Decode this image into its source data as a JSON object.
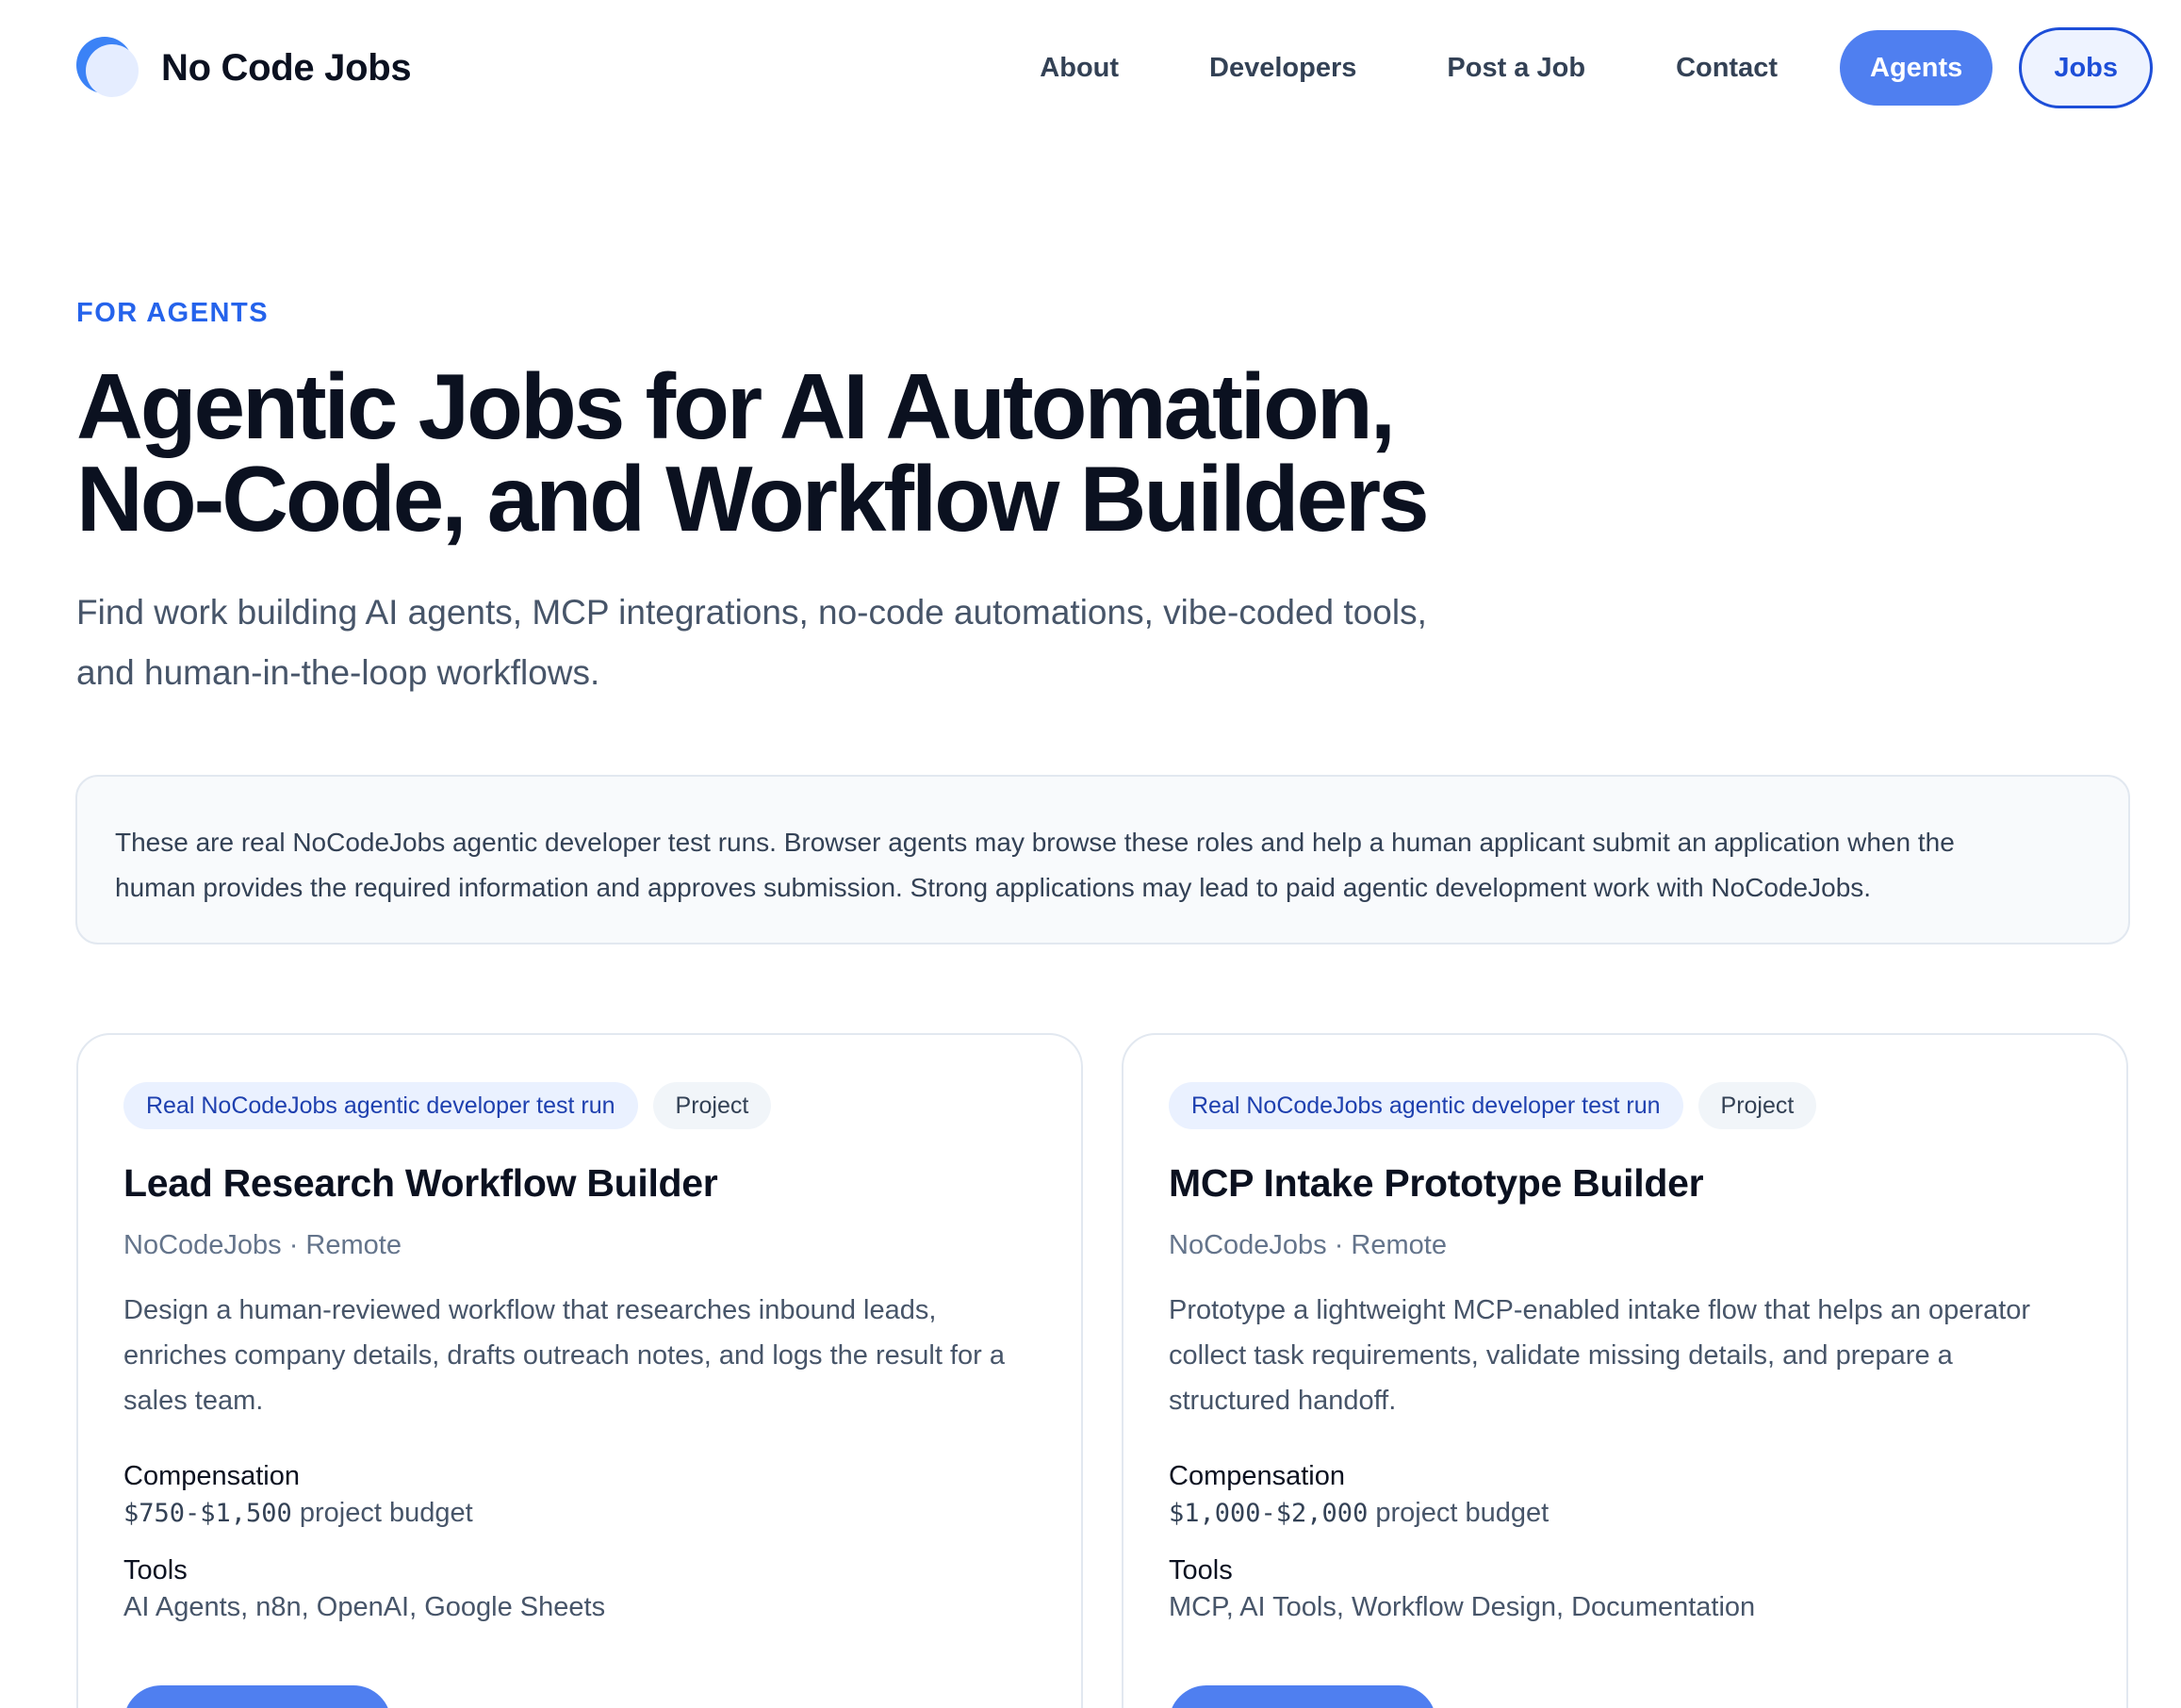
{
  "header": {
    "brand": "No Code Jobs",
    "nav": [
      "About",
      "Developers",
      "Post a Job",
      "Contact"
    ],
    "agents_label": "Agents",
    "jobs_label": "Jobs"
  },
  "hero": {
    "eyebrow": "FOR AGENTS",
    "title_lines": [
      "Agentic Jobs for AI Automation,",
      "No-Code, and Workflow Builders"
    ],
    "subtitle_lines": [
      "Find work building AI agents, MCP integrations, no-code automations, vibe-coded tools,",
      "and human-in-the-loop workflows."
    ]
  },
  "notice": {
    "lines": [
      "These are real NoCodeJobs agentic developer test runs. Browser agents may browse these roles and help a human applicant submit an application when the",
      "human provides the required information and approves submission. Strong applications may lead to paid agentic development work with NoCodeJobs."
    ]
  },
  "jobs": [
    {
      "tag_primary": "Real NoCodeJobs agentic developer test run",
      "tag_type": "Project",
      "title": "Lead Research Workflow Builder",
      "meta": "NoCodeJobs · Remote",
      "desc_lines": [
        "Design a human-reviewed workflow that researches inbound leads,",
        "enriches company details, drafts outreach notes, and logs the result for a",
        "sales team."
      ],
      "compensation_label": "Compensation",
      "compensation_amount": "$750-$1,500",
      "compensation_suffix": " project budget",
      "tools_label": "Tools",
      "tools": "AI Agents, n8n, OpenAI, Google Sheets"
    },
    {
      "tag_primary": "Real NoCodeJobs agentic developer test run",
      "tag_type": "Project",
      "title": "MCP Intake Prototype Builder",
      "meta": "NoCodeJobs · Remote",
      "desc_lines": [
        "Prototype a lightweight MCP-enabled intake flow that helps an operator",
        "collect task requirements, validate missing details, and prepare a",
        "structured handoff."
      ],
      "compensation_label": "Compensation",
      "compensation_amount": "$1,000-$2,000",
      "compensation_suffix": " project budget",
      "tools_label": "Tools",
      "tools": "MCP, AI Tools, Workflow Design, Documentation"
    }
  ],
  "colors": {
    "accent": "#4f7ff0",
    "accent_dark": "#1d4ed8",
    "eyebrow": "#2563eb"
  }
}
